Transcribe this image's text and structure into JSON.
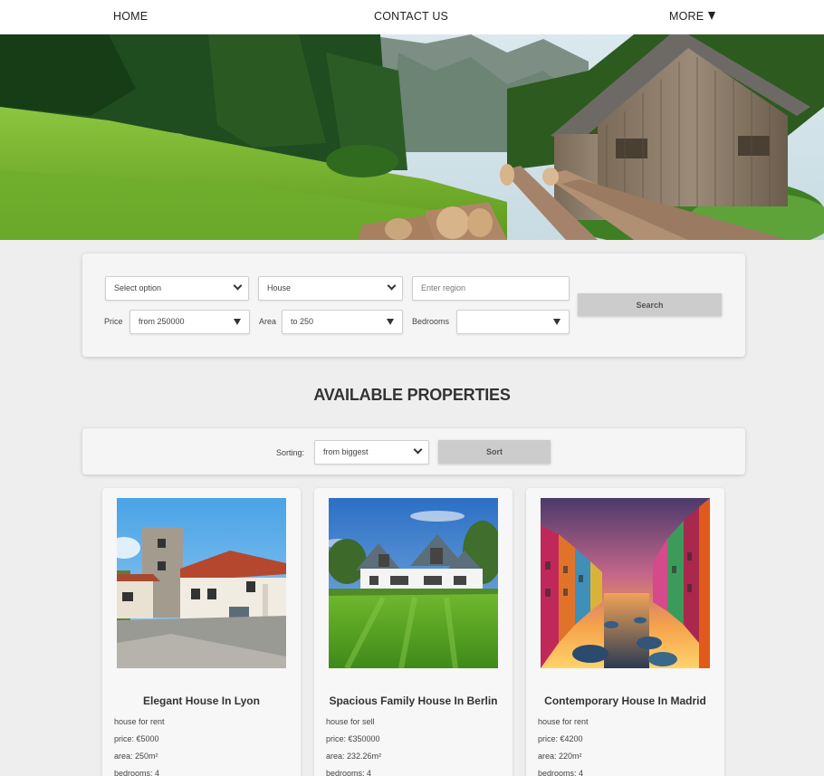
{
  "nav": {
    "home": "HOME",
    "contact": "CONTACT US",
    "more": "MORE"
  },
  "search": {
    "option_select": "Select option",
    "type_select": "House",
    "region_placeholder": "Enter region",
    "price_label": "Price",
    "price_value": "from 250000",
    "area_label": "Area",
    "area_value": "to 250",
    "bedrooms_label": "Bedrooms",
    "bedrooms_value": "",
    "search_button": "Search"
  },
  "heading": "AVAILABLE PROPERTIES",
  "sorting": {
    "label": "Sorting:",
    "value": "from biggest",
    "button": "Sort"
  },
  "properties": [
    {
      "title": "Elegant House In Lyon",
      "type": "house for rent",
      "price": "price: €5000",
      "area": "area: 250m²",
      "bedrooms": "bedrooms: 4"
    },
    {
      "title": "Spacious Family House In Berlin",
      "type": "house for sell",
      "price": "price: €350000",
      "area": "area: 232.26m²",
      "bedrooms": "bedrooms: 4"
    },
    {
      "title": "Contemporary House In Madrid",
      "type": "house for rent",
      "price": "price: €4200",
      "area": "area: 220m²",
      "bedrooms": "bedrooms: 4"
    }
  ]
}
